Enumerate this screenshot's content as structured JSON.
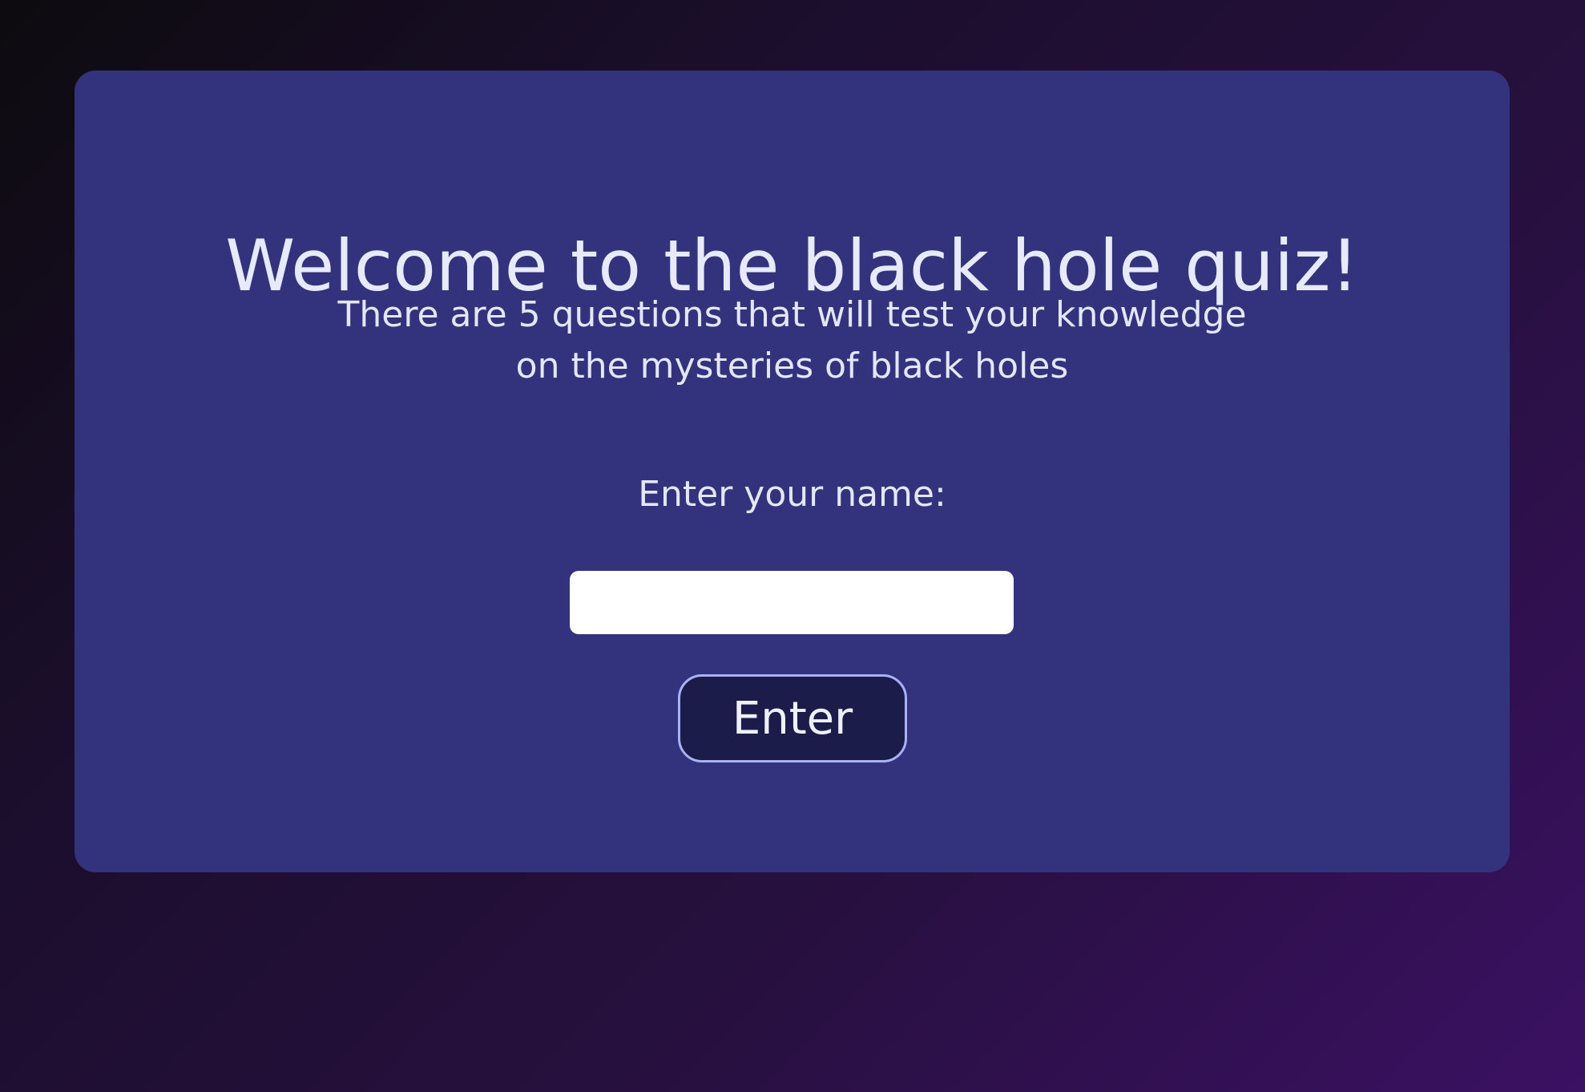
{
  "quiz": {
    "title": "Welcome to the black hole quiz!",
    "description": "There are 5 questions that will test your knowledge on the mysteries of black holes",
    "name_label": "Enter your name:",
    "name_input_value": "",
    "enter_button_label": "Enter"
  },
  "colors": {
    "card_background": "#33327d",
    "text": "#e6eafb",
    "button_background": "#1c1c4a",
    "button_border": "#a8b3f6",
    "input_background": "#ffffff"
  }
}
